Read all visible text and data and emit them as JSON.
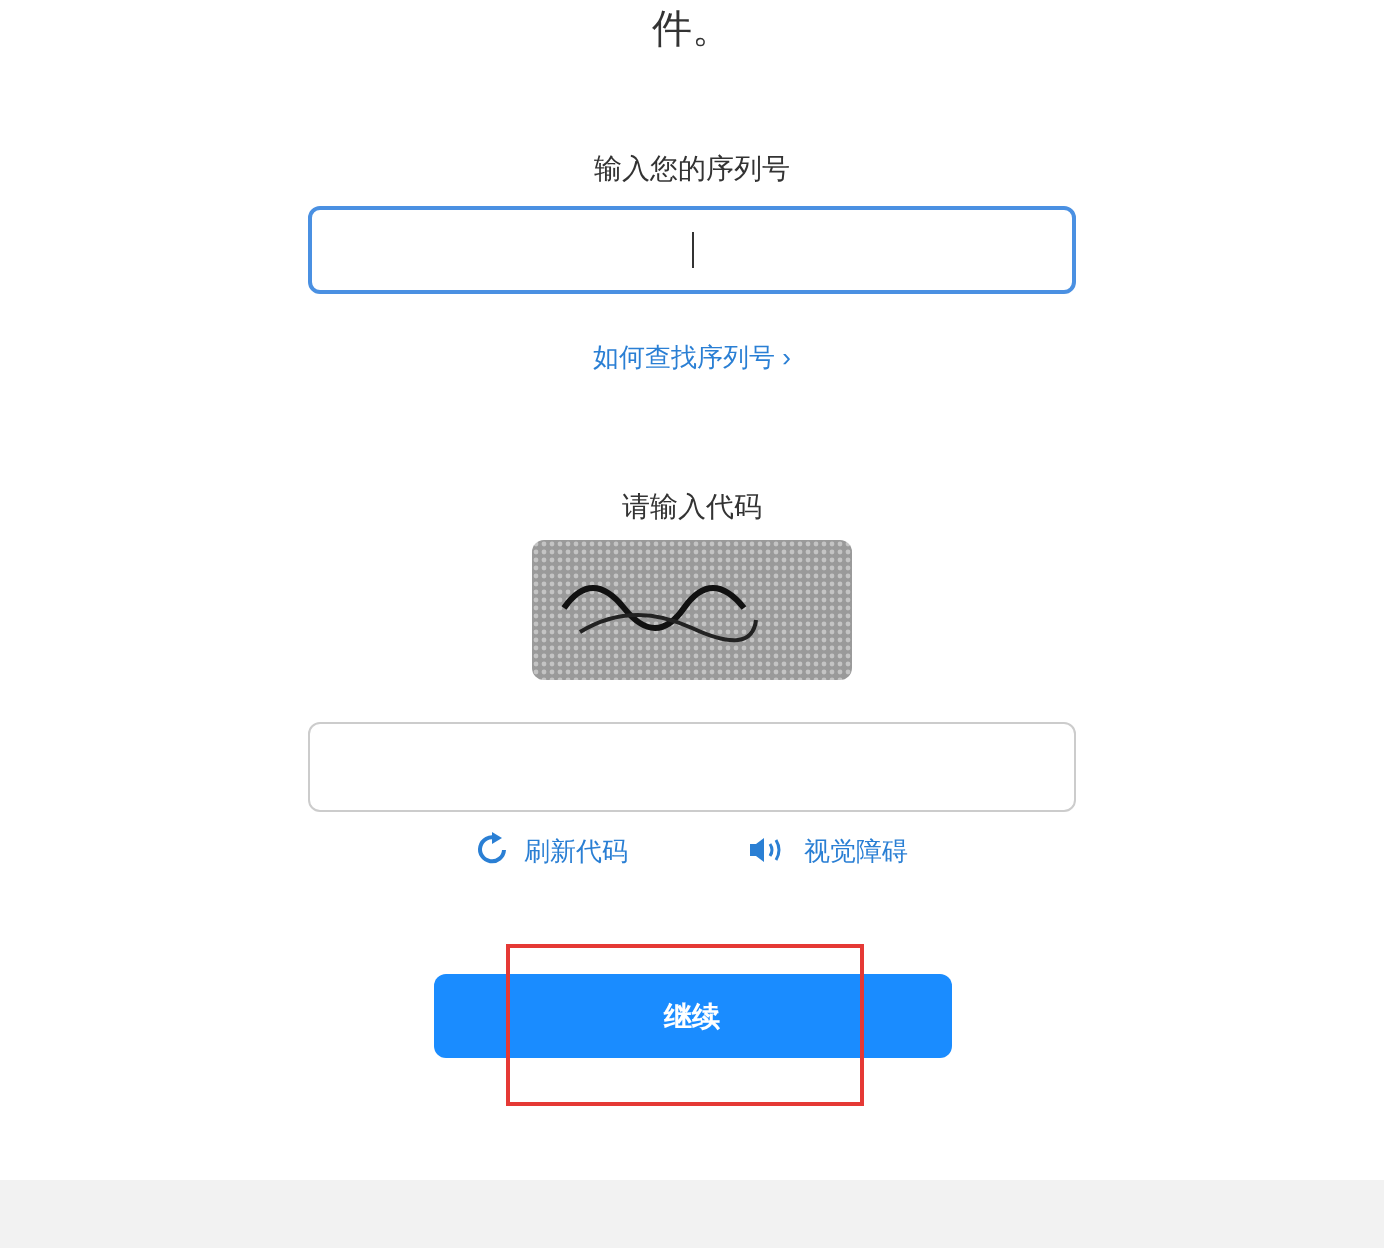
{
  "intro_tail": "件。",
  "serial": {
    "label": "输入您的序列号",
    "focused": true
  },
  "help_link": {
    "text": "如何查找序列号",
    "arrow": "›"
  },
  "code": {
    "label": "请输入代码"
  },
  "code_actions": [
    {
      "kind": "refresh",
      "text": "刷新代码"
    },
    {
      "kind": "audio",
      "text": "视觉障碍"
    }
  ],
  "continue_button": {
    "text": "继续",
    "highlighted": true
  }
}
